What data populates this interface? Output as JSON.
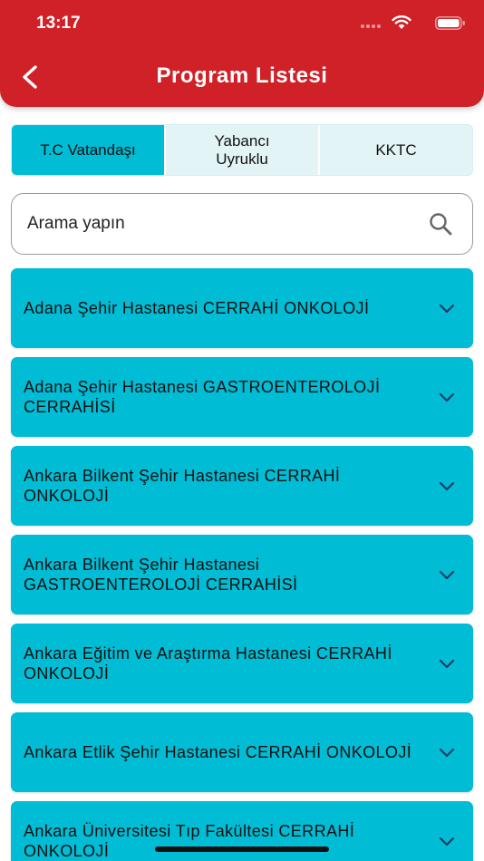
{
  "status_bar": {
    "time": "13:17"
  },
  "header": {
    "title": "Program Listesi",
    "back_icon": "chevron-left-icon"
  },
  "tabs": [
    {
      "label": "T.C Vatandaşı",
      "active": true
    },
    {
      "label": "Yabancı Uyruklu",
      "active": false
    },
    {
      "label": "KKTC",
      "active": false
    }
  ],
  "search": {
    "placeholder": "Arama yapın",
    "icon": "search-icon"
  },
  "programs": [
    {
      "label": "Adana Şehir Hastanesi CERRAHİ ONKOLOJİ"
    },
    {
      "label": "Adana Şehir Hastanesi GASTROENTEROLOJİ CERRAHİSİ"
    },
    {
      "label": "Ankara Bilkent Şehir Hastanesi CERRAHİ ONKOLOJİ"
    },
    {
      "label": "Ankara Bilkent Şehir Hastanesi GASTROENTEROLOJİ CERRAHİSİ"
    },
    {
      "label": "Ankara Eğitim ve Araştırma Hastanesi CERRAHİ ONKOLOJİ"
    },
    {
      "label": "Ankara Etlik Şehir Hastanesi CERRAHİ ONKOLOJİ"
    },
    {
      "label": "Ankara Üniversitesi Tıp Fakültesi CERRAHİ ONKOLOJİ"
    }
  ],
  "colors": {
    "header": "#cf2127",
    "accent": "#00bcd4",
    "tab_bg": "#e3f4f7"
  }
}
